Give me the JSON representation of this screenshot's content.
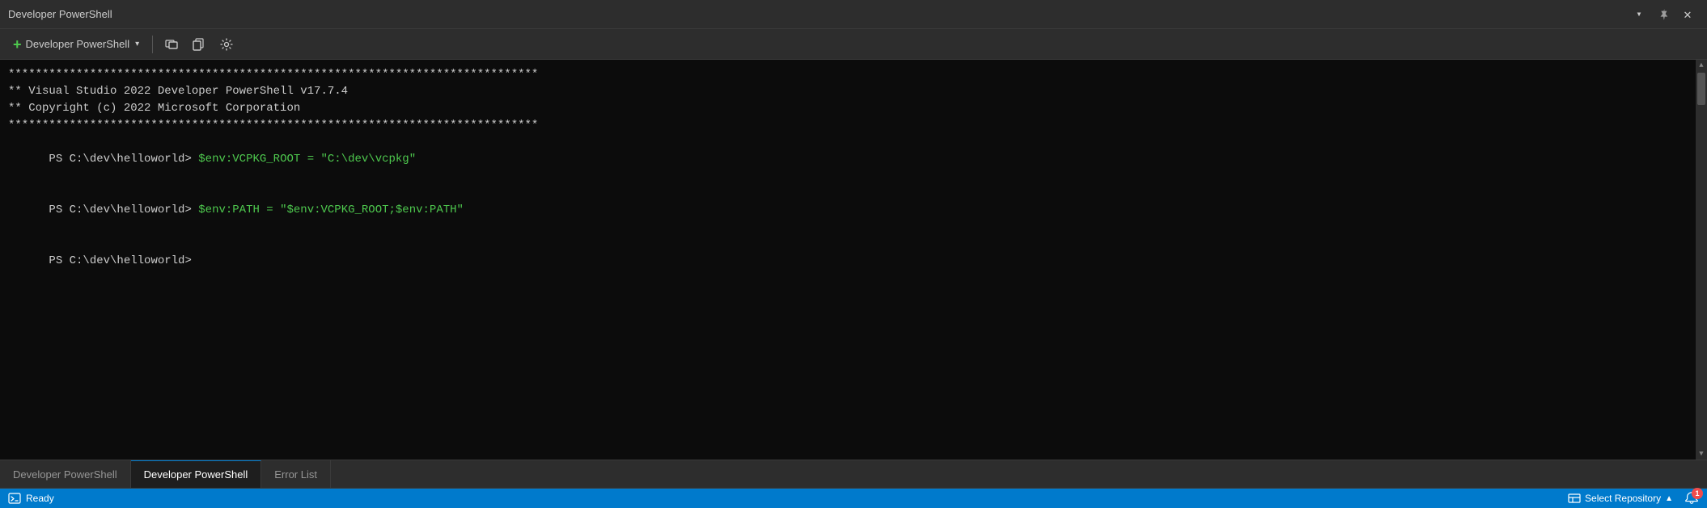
{
  "titleBar": {
    "title": "Developer PowerShell",
    "pinIcon": "📌",
    "closeIcon": "✕",
    "dropdownIcon": "▾"
  },
  "toolbar": {
    "addLabel": "Developer PowerShell",
    "splitIcon": "⧉",
    "copyIcon": "⎘",
    "gearIcon": "⚙"
  },
  "terminal": {
    "starLine": "******************************************************************************",
    "infoLine1": "** Visual Studio 2022 Developer PowerShell v17.7.4",
    "infoLine2": "** Copyright (c) 2022 Microsoft Corporation",
    "cmd1Prompt": "PS C:\\dev\\helloworld> ",
    "cmd1Green": "$env:VCPKG_ROOT = \"C:\\dev\\vcpkg\"",
    "cmd2Prompt": "PS C:\\dev\\helloworld> ",
    "cmd2Green": "$env:PATH = \"$env:VCPKG_ROOT;$env:PATH\"",
    "cmd3Prompt": "PS C:\\dev\\helloworld> "
  },
  "tabs": [
    {
      "label": "Developer PowerShell",
      "active": false
    },
    {
      "label": "Developer PowerShell",
      "active": true
    },
    {
      "label": "Error List",
      "active": false
    }
  ],
  "statusBar": {
    "readyIcon": "⬜",
    "readyText": "Ready",
    "repoIcon": "⬜",
    "repoLabel": "Select Repository",
    "repoArrow": "▲",
    "bellIcon": "🔔",
    "notifCount": "1"
  }
}
